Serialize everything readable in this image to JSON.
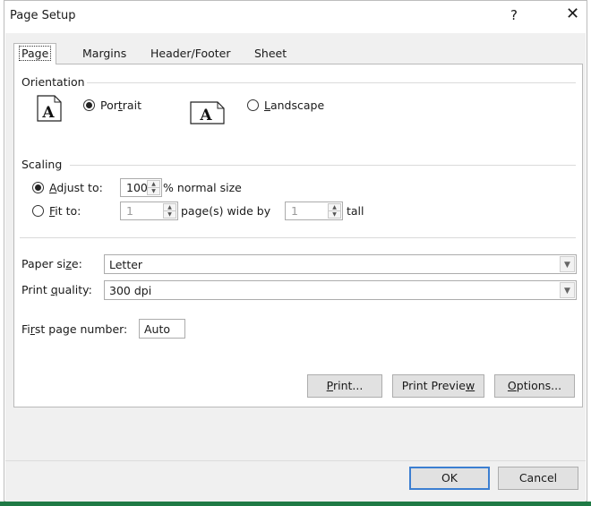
{
  "window": {
    "title": "Page Setup",
    "help_label": "?",
    "close_label": "✕"
  },
  "tabs": [
    {
      "label": "Page",
      "active": true
    },
    {
      "label": "Margins"
    },
    {
      "label": "Header/Footer"
    },
    {
      "label": "Sheet"
    }
  ],
  "orientation": {
    "title": "Orientation",
    "portrait": {
      "pre": "Por",
      "key": "t",
      "post": "rait",
      "selected": true
    },
    "landscape": {
      "pre": "",
      "key": "L",
      "post": "andscape",
      "selected": false
    },
    "icon_letter": "A"
  },
  "scaling": {
    "title": "Scaling",
    "adjust": {
      "pre": "",
      "key": "A",
      "post": "djust to:",
      "value": "100",
      "suffix": "% normal size",
      "selected": true
    },
    "fit": {
      "pre": "",
      "key": "F",
      "post": "it to:",
      "wide_value": "1",
      "wide_label": "page(s) wide by",
      "tall_value": "1",
      "tall_label": "tall",
      "selected": false
    }
  },
  "paper": {
    "label_pre": "Paper si",
    "label_key": "z",
    "label_post": "e:",
    "value": "Letter"
  },
  "quality": {
    "label_pre": "Print ",
    "label_key": "q",
    "label_post": "uality:",
    "value": "300 dpi"
  },
  "first_page": {
    "label_pre": "Fi",
    "label_key": "r",
    "label_post": "st page number:",
    "value": "Auto"
  },
  "buttons": {
    "print": {
      "pre": "",
      "key": "P",
      "post": "rint..."
    },
    "preview": {
      "pre": "Print Previe",
      "key": "w",
      "post": ""
    },
    "options": {
      "pre": "",
      "key": "O",
      "post": "ptions..."
    },
    "ok": "OK",
    "cancel": "Cancel"
  },
  "colors": {
    "accent_border": "#3c7fd1",
    "app_strip": "#1f7a45",
    "dialog_bg": "#f0f0f0"
  }
}
